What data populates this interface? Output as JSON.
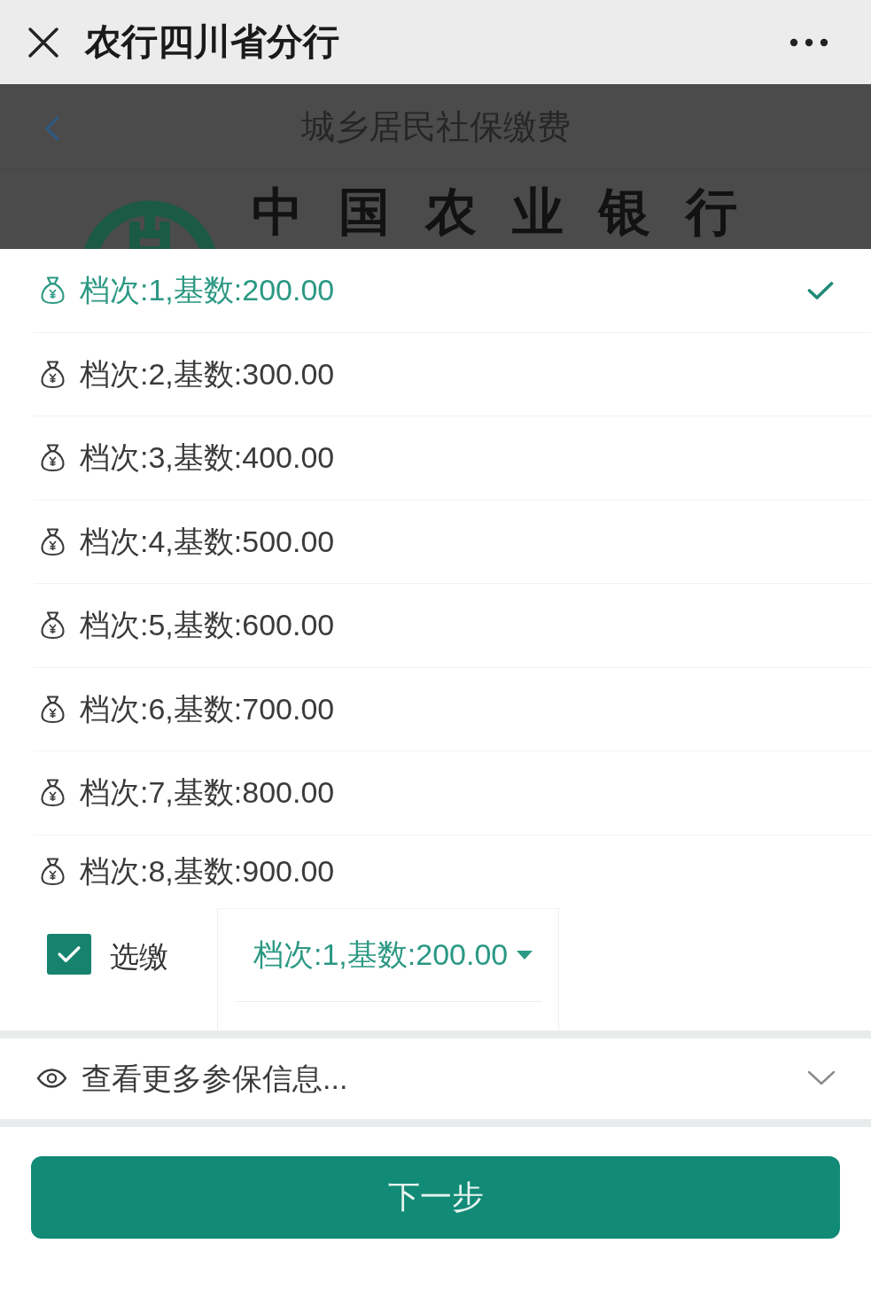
{
  "top_bar": {
    "title": "农行四川省分行"
  },
  "page_header": {
    "title": "城乡居民社保缴费"
  },
  "banner": {
    "text": "中国农业银行"
  },
  "options": [
    {
      "label": "档次:1,基数:200.00",
      "selected": true
    },
    {
      "label": "档次:2,基数:300.00",
      "selected": false
    },
    {
      "label": "档次:3,基数:400.00",
      "selected": false
    },
    {
      "label": "档次:4,基数:500.00",
      "selected": false
    },
    {
      "label": "档次:5,基数:600.00",
      "selected": false
    },
    {
      "label": "档次:6,基数:700.00",
      "selected": false
    },
    {
      "label": "档次:7,基数:800.00",
      "selected": false
    },
    {
      "label": "档次:8,基数:900.00",
      "selected": false
    }
  ],
  "selective_payment": {
    "label": "选缴",
    "checked": true
  },
  "tier_select": {
    "value": "档次:1,基数:200.00"
  },
  "more_info": {
    "label": "查看更多参保信息...",
    "expanded": false
  },
  "next_button": {
    "label": "下一步"
  }
}
